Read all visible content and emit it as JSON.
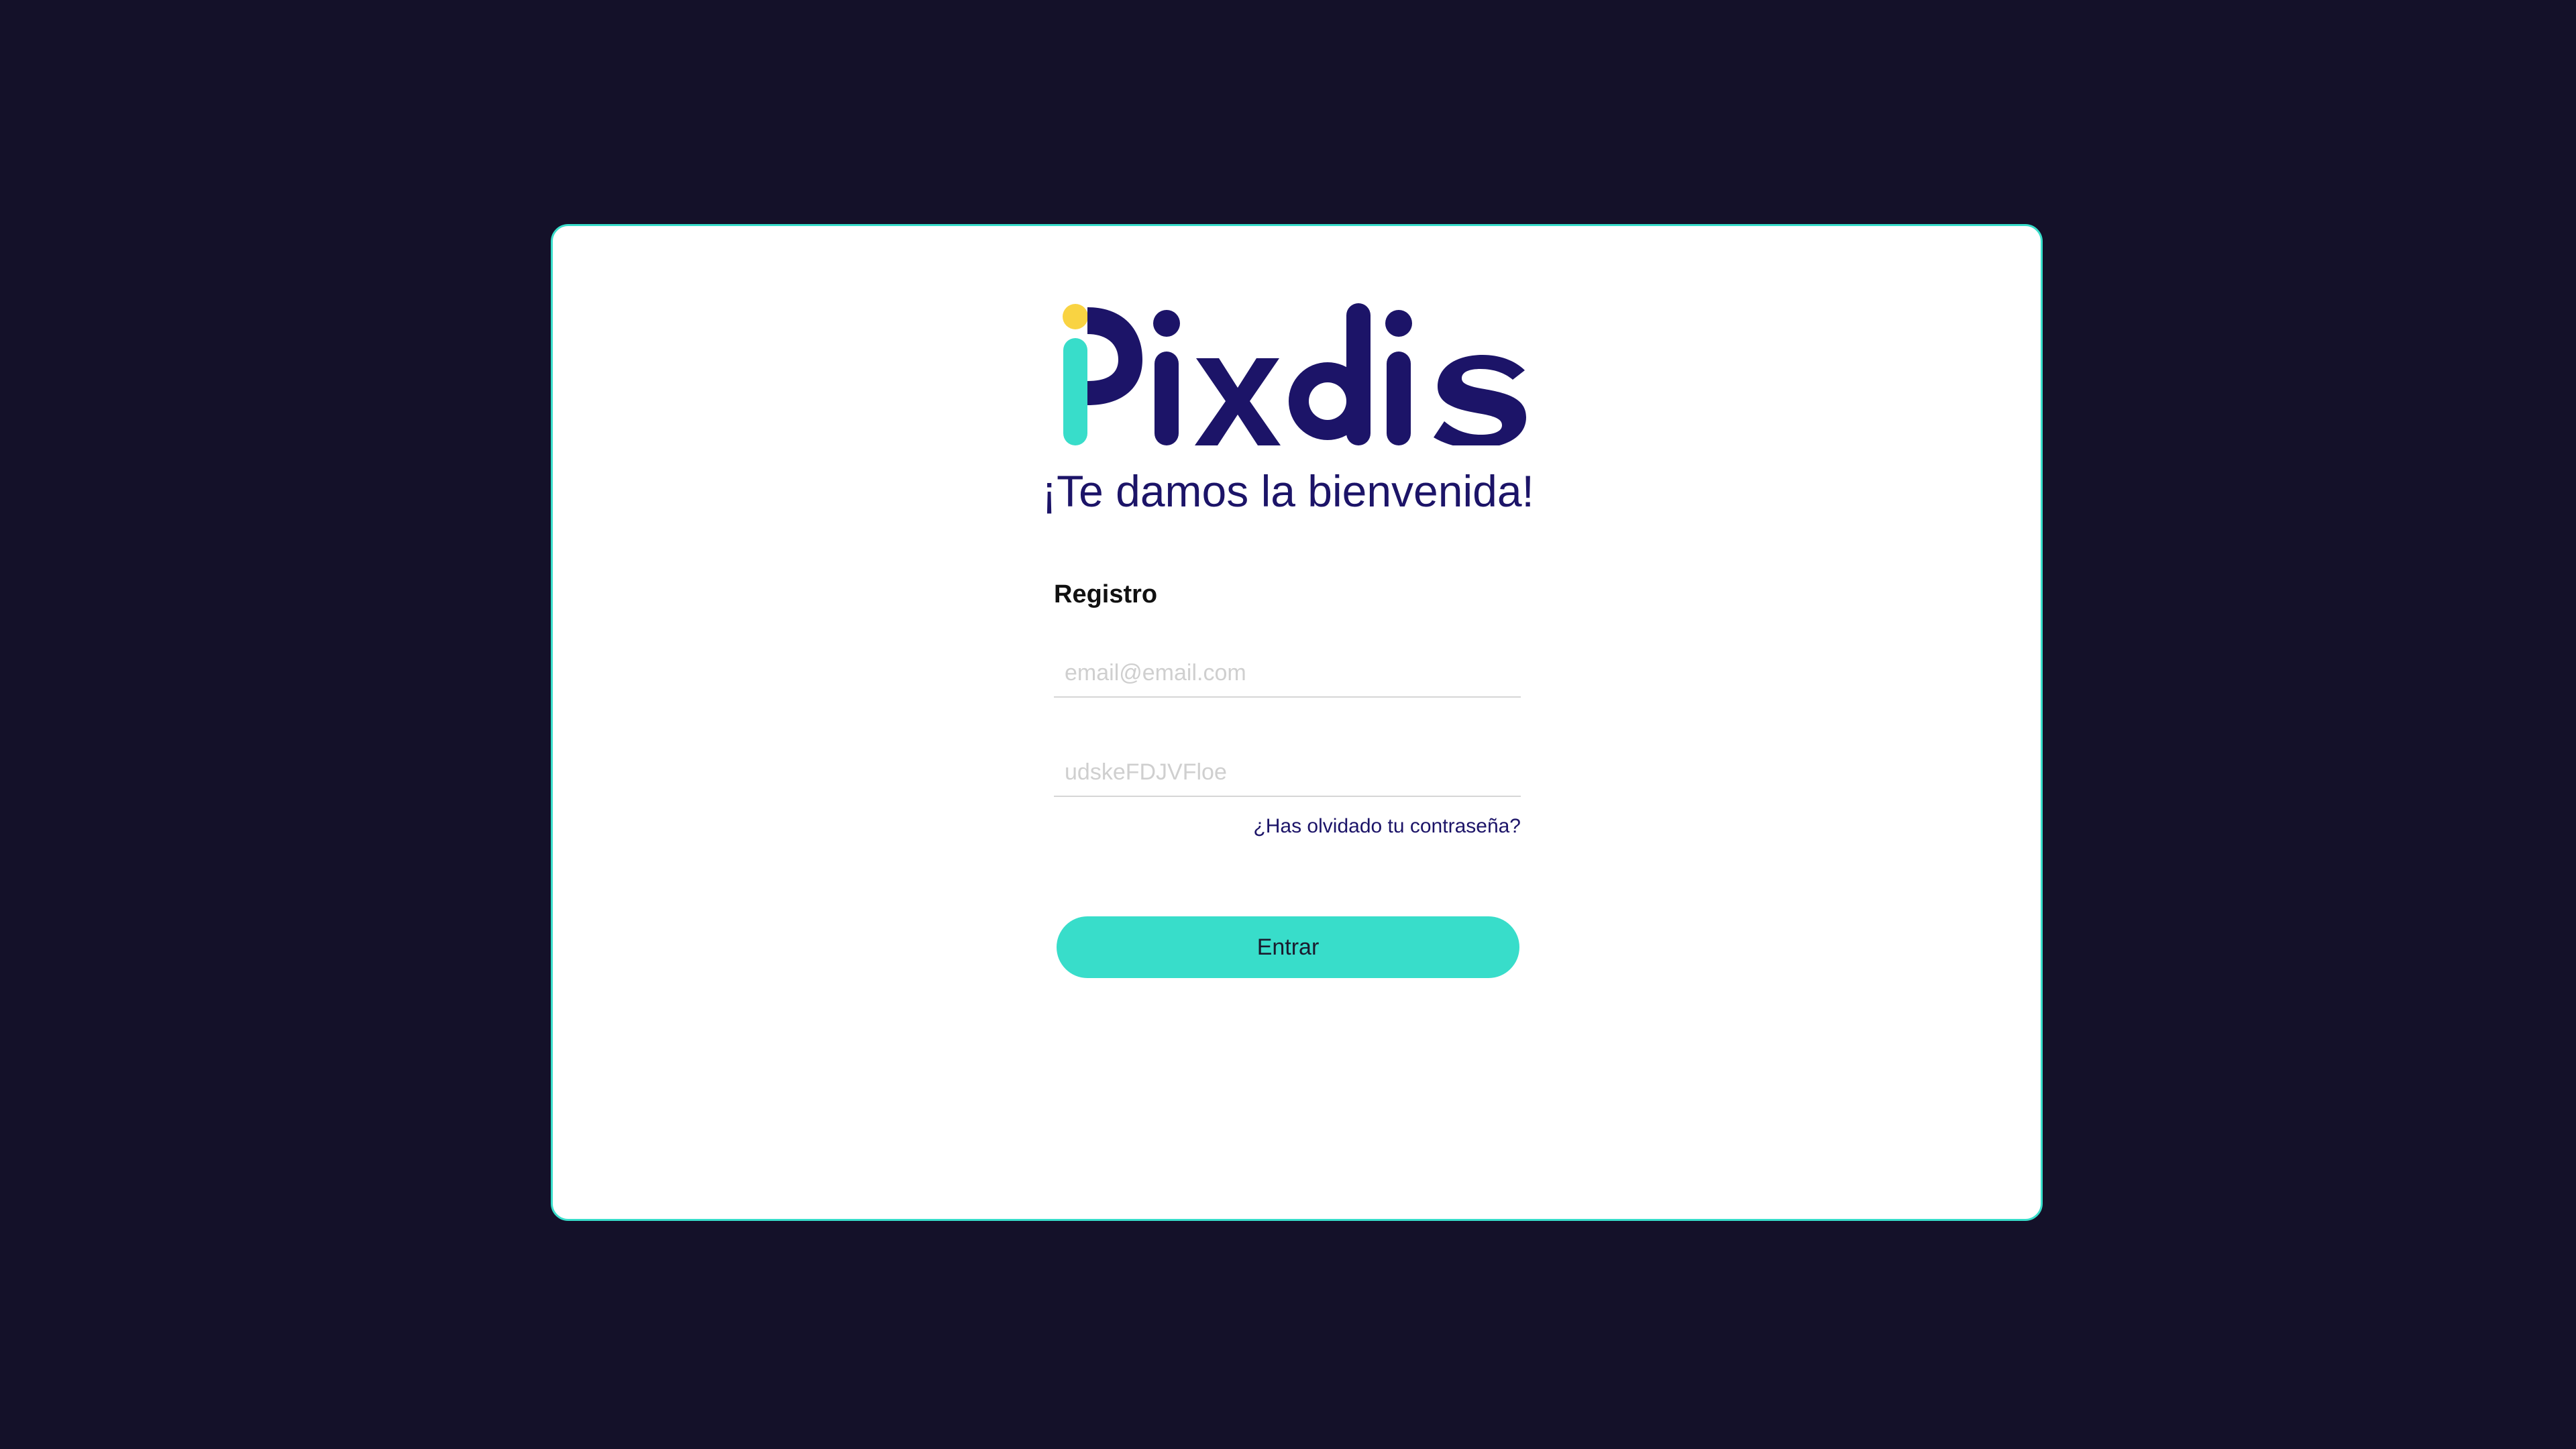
{
  "brand": {
    "name": "Pixdis",
    "colors": {
      "background": "#141129",
      "card": "#ffffff",
      "accent": "#38ddca",
      "primary": "#1c1468",
      "dot": "#f9d342"
    }
  },
  "welcome": {
    "title": "¡Te damos la bienvenida!"
  },
  "form": {
    "section_title": "Registro",
    "email_placeholder": "email@email.com",
    "password_placeholder": "udskeFDJVFloe",
    "forgot_label": "¿Has olvidado tu contraseña?",
    "submit_label": "Entrar"
  }
}
